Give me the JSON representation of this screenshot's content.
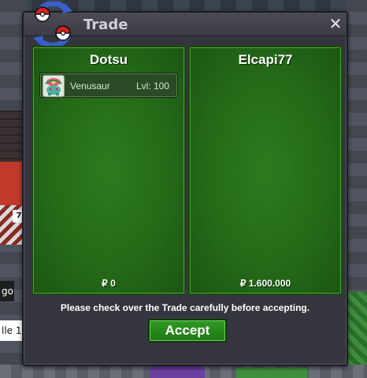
{
  "window": {
    "title": "Trade",
    "close_icon": "✕"
  },
  "left_panel": {
    "trainer": "Dotsu",
    "items": [
      {
        "name": "Venusaur",
        "level": "Lvl: 100",
        "icon": "venusaur-sprite-icon"
      }
    ],
    "money": "₽ 0"
  },
  "right_panel": {
    "trainer": "Elcapi77",
    "items": [],
    "money": "₽ 1.600.000"
  },
  "notice": "Please check over the Trade carefully before accepting.",
  "accept_label": "Accept",
  "background": {
    "sign1": "7",
    "sign2": "go",
    "sign3": "lle 1"
  },
  "colors": {
    "panel_green": "#2d7a1f",
    "button_green": "#2f9b22",
    "window_bg": "#35353f"
  }
}
